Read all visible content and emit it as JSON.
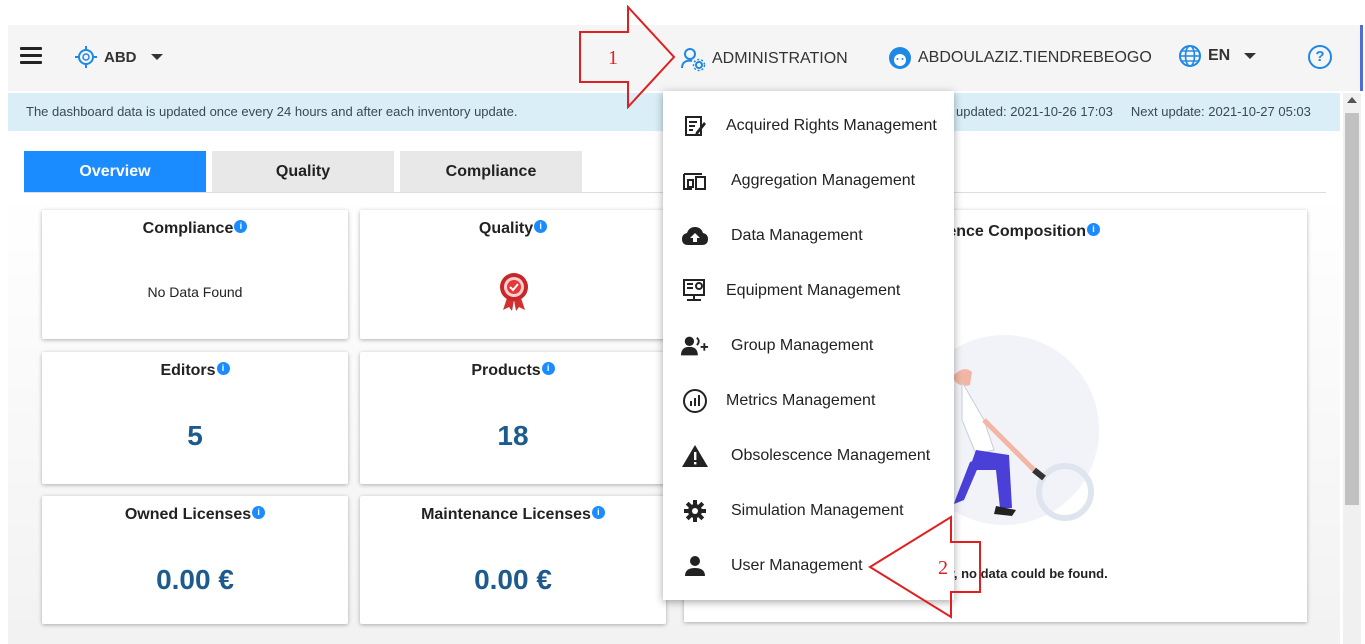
{
  "topbar": {
    "entity": "ABD",
    "administration": "ADMINISTRATION",
    "username": "ABDOULAZIZ.TIENDREBEOGO",
    "language": "EN",
    "help": "?"
  },
  "infobar": {
    "message": "The dashboard data is updated once every 24 hours and after each inventory update.",
    "updated": "updated: 2021-10-26 17:03",
    "next_update": "Next update: 2021-10-27 05:03"
  },
  "tabs": [
    {
      "label": "Overview",
      "active": true
    },
    {
      "label": "Quality",
      "active": false
    },
    {
      "label": "Compliance",
      "active": false
    }
  ],
  "cards": {
    "compliance": {
      "title": "Compliance",
      "value": "No Data Found"
    },
    "quality": {
      "title": "Quality"
    },
    "editors": {
      "title": "Editors",
      "value": "5"
    },
    "products": {
      "title": "Products",
      "value": "18"
    },
    "owned_licenses": {
      "title": "Owned Licenses",
      "value": "0.00 €"
    },
    "maintenance_licenses": {
      "title": "Maintenance Licenses",
      "value": "0.00 €"
    },
    "licence_composition": {
      "title": "icence Composition",
      "message": "ly, no data could be found."
    }
  },
  "info_icon": "i",
  "dropdown": {
    "items": [
      {
        "label": "Acquired Rights Management",
        "icon": "edit-document-icon"
      },
      {
        "label": "Aggregation Management",
        "icon": "devices-icon"
      },
      {
        "label": "Data Management",
        "icon": "cloud-upload-icon"
      },
      {
        "label": "Equipment Management",
        "icon": "equipment-icon"
      },
      {
        "label": "Group Management",
        "icon": "group-add-icon"
      },
      {
        "label": "Metrics Management",
        "icon": "metrics-icon"
      },
      {
        "label": "Obsolescence Management",
        "icon": "warning-icon"
      },
      {
        "label": "Simulation Management",
        "icon": "settings-gear-icon"
      },
      {
        "label": "User Management",
        "icon": "person-icon"
      }
    ]
  },
  "annotations": {
    "step1": "1",
    "step2": "2"
  },
  "colors": {
    "accent": "#1a8cff",
    "value_text": "#1d5b8f",
    "infobar_bg": "#d9eef6",
    "annotation_red": "#e02020"
  }
}
